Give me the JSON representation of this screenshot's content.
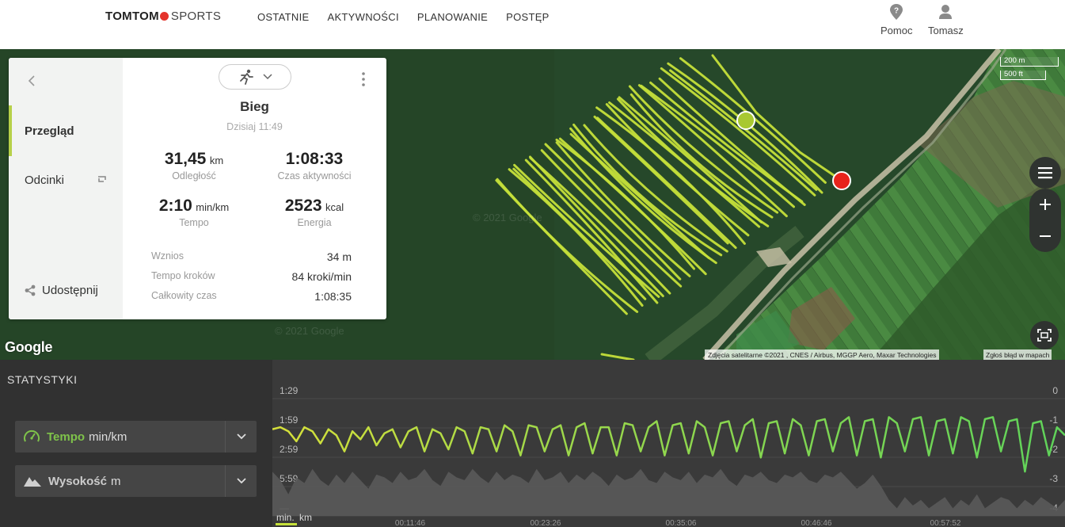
{
  "header": {
    "logo_brand": "TOMTOM",
    "logo_product": "SPORTS",
    "nav": [
      "OSTATNIE",
      "AKTYWNOŚCI",
      "PLANOWANIE",
      "POSTĘP"
    ],
    "help_label": "Pomoc",
    "user_label": "Tomasz"
  },
  "map": {
    "google_logo": "Google",
    "watermark": "© 2021 Google",
    "attribution": "Zdjęcia satelitarne ©2021 , CNES / Airbus, MGGP Aero, Maxar Technologies",
    "report_error": "Zgłoś błąd w mapach",
    "scale_metric": "200 m",
    "scale_imperial": "500 ft",
    "start_color": "#a8c832",
    "end_color": "#e8231c",
    "route_color": "#c5e03a"
  },
  "summary": {
    "tabs": [
      "Przegląd",
      "Odcinki"
    ],
    "share_label": "Udostępnij",
    "activity_type": "Bieg",
    "date": "Dzisiaj 11:49",
    "stats": {
      "distance": {
        "value": "31,45",
        "unit": "km",
        "label": "Odległość"
      },
      "active_time": {
        "value": "1:08:33",
        "label": "Czas aktywności"
      },
      "pace": {
        "value": "2:10",
        "unit": "min/km",
        "label": "Tempo"
      },
      "energy": {
        "value": "2523",
        "unit": "kcal",
        "label": "Energia"
      }
    },
    "details": [
      {
        "label": "Wznios",
        "value": "34 m"
      },
      {
        "label": "Tempo kroków",
        "value": "84 kroki/min"
      },
      {
        "label": "Całkowity czas",
        "value": "1:08:35"
      }
    ]
  },
  "stats_panel": {
    "title": "STATYSTYKI",
    "metric1": {
      "name": "Tempo",
      "unit": "min/km"
    },
    "metric2": {
      "name": "Wysokość",
      "unit": "m"
    }
  },
  "chart_data": {
    "type": "line",
    "x_unit_labels": [
      "min.",
      "km"
    ],
    "x_ticks": [
      "00:11:46",
      "00:23:26",
      "00:35:06",
      "00:46:46",
      "00:57:52"
    ],
    "y_left_ticks": [
      "1:29",
      "1:59",
      "2:59",
      "5:59",
      "—"
    ],
    "y_right_ticks": [
      "0",
      "-1",
      "-2",
      "-3",
      "-4"
    ],
    "series": [
      {
        "name": "Tempo",
        "color": "#5fd35a",
        "values": [
          2.05,
          2.0,
          2.1,
          2.35,
          2.0,
          2.1,
          2.4,
          2.05,
          2.2,
          2.6,
          2.1,
          2.3,
          2.0,
          2.45,
          2.15,
          2.05,
          2.5,
          2.1,
          2.0,
          2.6,
          2.05,
          2.15,
          2.55,
          2.0,
          2.1,
          2.65,
          2.0,
          2.05,
          2.6,
          1.95,
          2.1,
          2.7,
          1.95,
          2.0,
          2.6,
          2.05,
          1.95,
          2.7,
          2.0,
          1.9,
          2.65,
          2.0,
          2.0,
          2.7,
          1.9,
          1.95,
          2.6,
          2.0,
          1.85,
          2.7,
          1.95,
          1.9,
          2.65,
          1.85,
          2.0,
          2.7,
          1.9,
          1.85,
          2.6,
          1.95,
          1.8,
          2.75,
          1.9,
          1.85,
          2.65,
          1.8,
          1.95,
          2.7,
          1.85,
          1.8,
          2.6,
          1.9,
          1.75,
          2.7,
          1.85,
          1.8,
          2.75,
          1.75,
          1.9,
          2.6,
          1.8,
          1.75,
          2.7,
          1.85,
          1.8,
          2.65,
          1.75,
          1.85,
          2.75,
          1.8,
          1.75,
          2.6,
          1.85,
          1.8,
          3.1,
          1.9,
          1.85,
          2.7,
          2.0,
          2.2
        ]
      },
      {
        "name": "Wysokość",
        "color": "#5a5a5a",
        "values": [
          -2.6,
          -2.9,
          -3.4,
          -2.8,
          -3.0,
          -2.5,
          -2.9,
          -3.1,
          -2.7,
          -3.0,
          -2.6,
          -2.9,
          -3.2,
          -2.7,
          -2.8,
          -3.0,
          -2.6,
          -2.9,
          -2.8,
          -2.5,
          -2.9,
          -3.1,
          -2.6,
          -2.8,
          -2.9,
          -2.5,
          -2.8,
          -3.0,
          -2.6,
          -2.9,
          -2.7,
          -2.8,
          -3.0,
          -2.5,
          -2.9,
          -2.8,
          -2.6,
          -3.0,
          -2.7,
          -2.9,
          -2.6,
          -2.8,
          -3.1,
          -2.7,
          -2.9,
          -2.8,
          -2.5,
          -2.9,
          -3.0,
          -2.6,
          -2.8,
          -2.9,
          -2.6,
          -3.0,
          -2.7,
          -2.8,
          -2.5,
          -2.9,
          -3.1,
          -2.7,
          -2.8,
          -2.6,
          -2.9,
          -3.0,
          -2.7,
          -2.8,
          -2.6,
          -2.9,
          -3.0,
          -2.7,
          -2.8,
          -2.6,
          -2.9,
          -3.2,
          -3.0,
          -2.7,
          -3.1,
          -3.6,
          -3.9,
          -3.5,
          -3.8,
          -3.6,
          -3.9,
          -3.7,
          -3.5,
          -3.9,
          -3.6,
          -3.8,
          -3.4,
          -3.9,
          -3.7,
          -3.5,
          -3.6,
          -3.9,
          -3.6,
          -3.8,
          -3.5,
          -3.7,
          -3.9,
          -3.6
        ]
      }
    ],
    "ylim_pace": [
      1.29,
      4.2
    ],
    "ylim_elev": [
      -4,
      0
    ],
    "grid": true
  }
}
